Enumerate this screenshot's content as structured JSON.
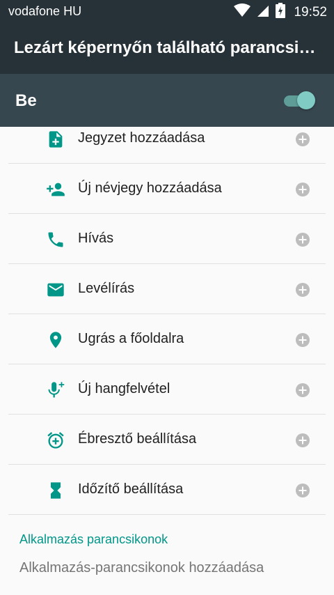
{
  "status_bar": {
    "carrier": "vodafone HU",
    "time": "19:52"
  },
  "app_bar": {
    "title": "Lezárt képernyőn található parancsikonok"
  },
  "master_switch": {
    "label": "Be",
    "state": "on"
  },
  "shortcuts": [
    {
      "label": "Jegyzet hozzáadása",
      "icon": "note-add-icon"
    },
    {
      "label": "Új névjegy hozzáadása",
      "icon": "person-add-icon"
    },
    {
      "label": "Hívás",
      "icon": "phone-icon"
    },
    {
      "label": "Levélírás",
      "icon": "email-icon"
    },
    {
      "label": "Ugrás a főoldalra",
      "icon": "place-icon"
    },
    {
      "label": "Új hangfelvétel",
      "icon": "mic-add-icon"
    },
    {
      "label": "Ébresztő beállítása",
      "icon": "alarm-add-icon"
    },
    {
      "label": "Időzítő beállítása",
      "icon": "hourglass-icon"
    }
  ],
  "app_shortcuts": {
    "header": "Alkalmazás parancsikonok",
    "add_label": "Alkalmazás-parancsikonok hozzáadása"
  },
  "colors": {
    "accent": "#009688",
    "toolbar": "#263238",
    "switchbar": "#37474f",
    "add_icon": "#bdbdbd"
  }
}
